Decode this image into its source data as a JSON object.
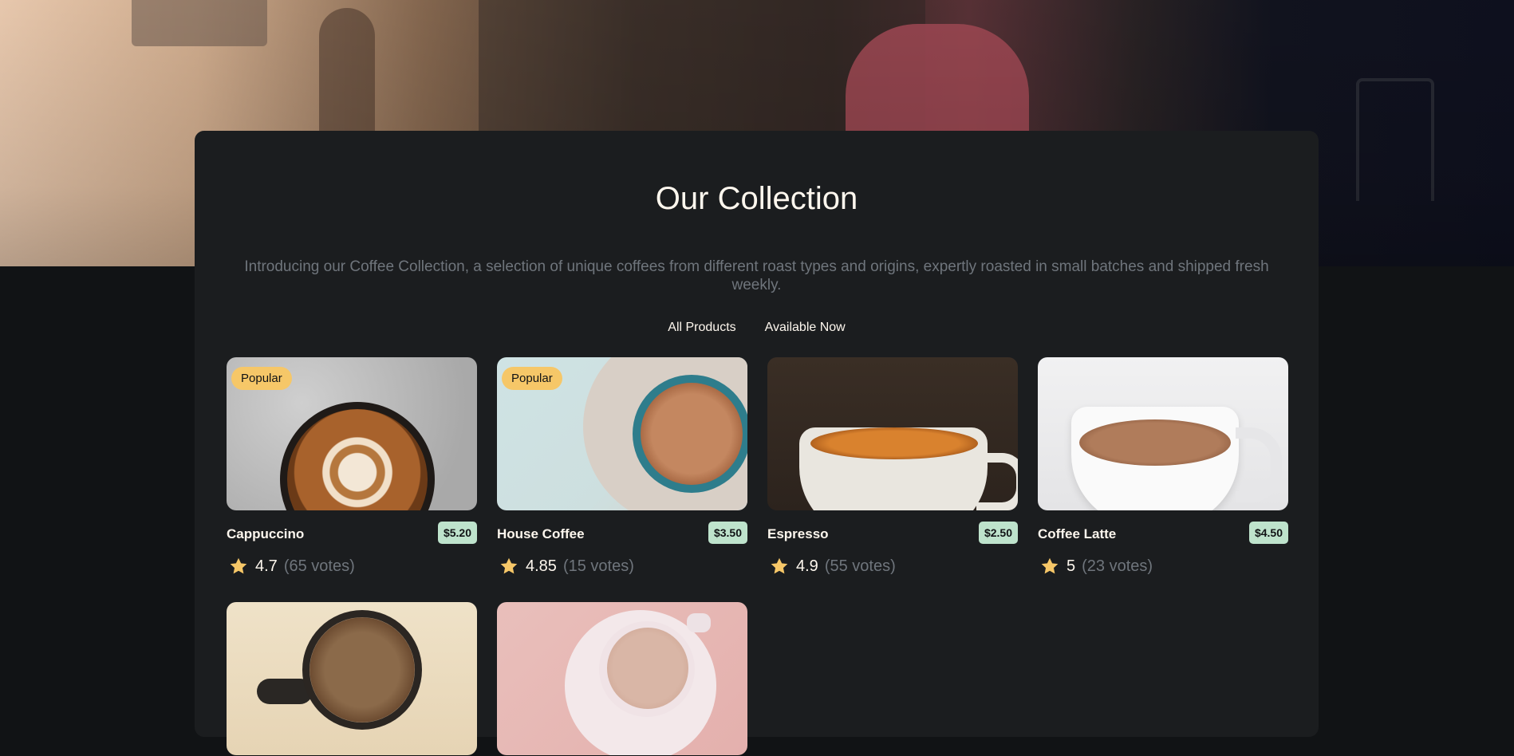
{
  "section": {
    "title": "Our Collection",
    "intro": "Introducing our Coffee Collection, a selection of unique coffees from different roast types and origins, expertly roasted in small batches and shipped fresh weekly."
  },
  "filters": [
    "All Products",
    "Available Now"
  ],
  "products": [
    {
      "name": "Cappuccino",
      "price": "$5.20",
      "badge": "Popular",
      "rating": "4.7",
      "votes": "(65 votes)"
    },
    {
      "name": "House Coffee",
      "price": "$3.50",
      "badge": "Popular",
      "rating": "4.85",
      "votes": "(15 votes)"
    },
    {
      "name": "Espresso",
      "price": "$2.50",
      "badge": "",
      "rating": "4.9",
      "votes": "(55 votes)"
    },
    {
      "name": "Coffee Latte",
      "price": "$4.50",
      "badge": "",
      "rating": "5",
      "votes": "(23 votes)"
    }
  ],
  "colors": {
    "page_bg": "#111315",
    "panel_bg": "#1B1D1F",
    "badge_bg": "#F6C768",
    "price_bg": "#BEE3CC",
    "text_light": "#FEF7EE",
    "text_muted": "#6F757C"
  },
  "icons": {
    "rating": "star-icon"
  }
}
